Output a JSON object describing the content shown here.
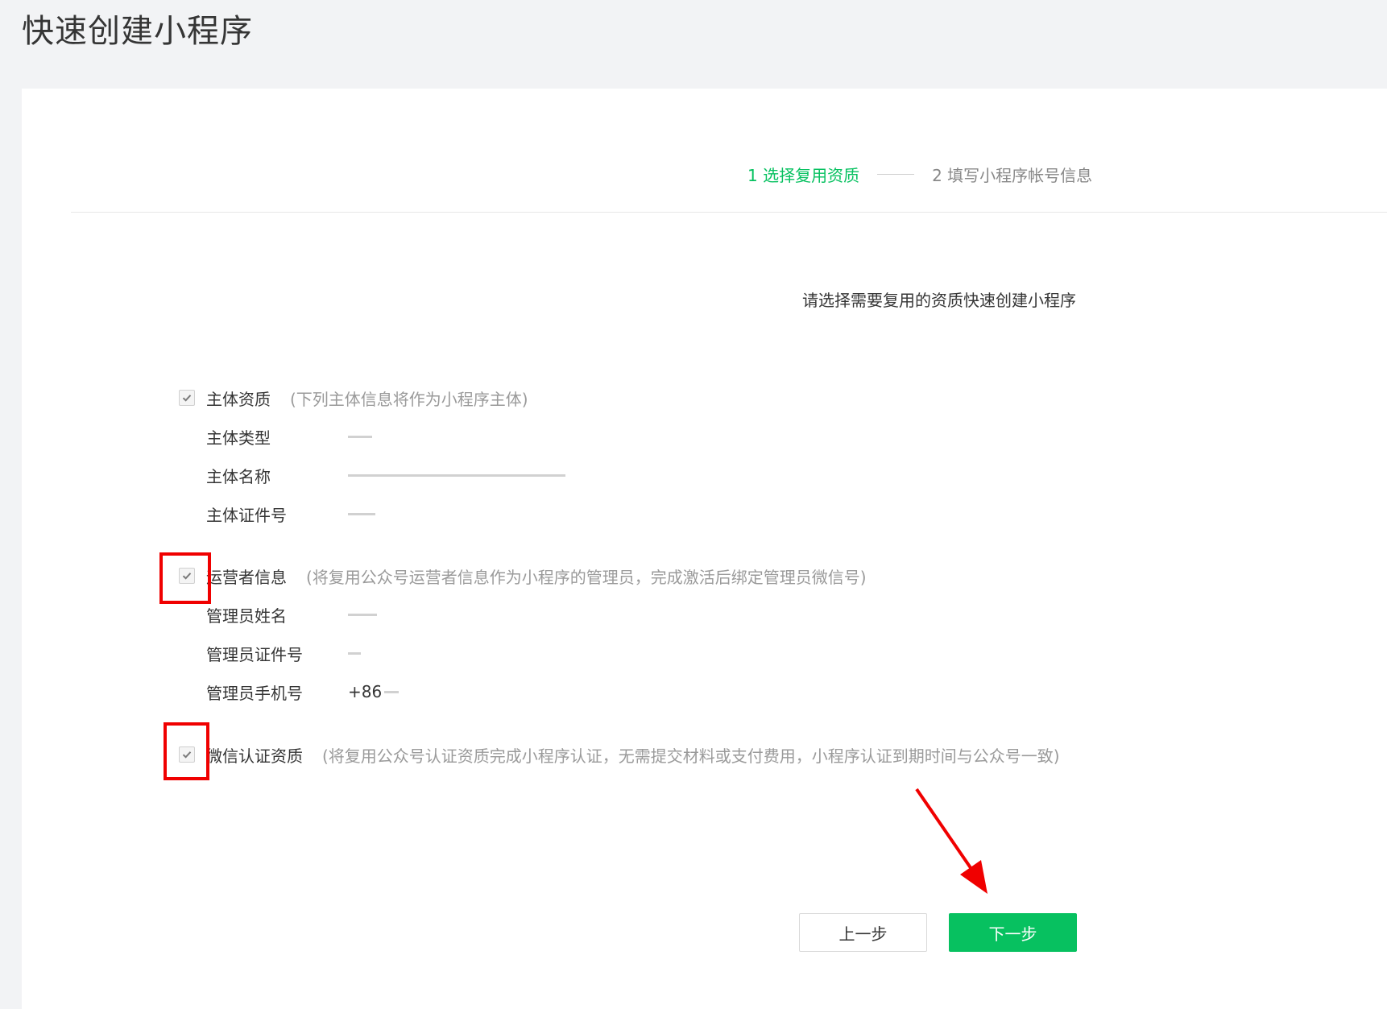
{
  "page": {
    "title": "快速创建小程序"
  },
  "steps": {
    "active": "1 选择复用资质",
    "next": "2 填写小程序帐号信息"
  },
  "intro": "请选择需要复用的资质快速创建小程序",
  "sections": {
    "subject": {
      "title": "主体资质",
      "note": "(下列主体信息将作为小程序主体)",
      "checked": true,
      "fields": [
        {
          "label": "主体类型",
          "value": ""
        },
        {
          "label": "主体名称",
          "value": ""
        },
        {
          "label": "主体证件号",
          "value": ""
        }
      ]
    },
    "operator": {
      "title": "运营者信息",
      "note": "(将复用公众号运营者信息作为小程序的管理员，完成激活后绑定管理员微信号)",
      "checked": true,
      "fields": [
        {
          "label": "管理员姓名",
          "value": ""
        },
        {
          "label": "管理员证件号",
          "value": ""
        },
        {
          "label": "管理员手机号",
          "value": "+86"
        }
      ]
    },
    "certification": {
      "title": "微信认证资质",
      "note": "(将复用公众号认证资质完成小程序认证，无需提交材料或支付费用，小程序认证到期时间与公众号一致)",
      "checked": true
    }
  },
  "buttons": {
    "prev": "上一步",
    "next": "下一步"
  },
  "colors": {
    "accent": "#07c160",
    "annotation": "#f00000",
    "muted": "#9a9a9a"
  },
  "icons": {
    "check": "check-icon"
  }
}
